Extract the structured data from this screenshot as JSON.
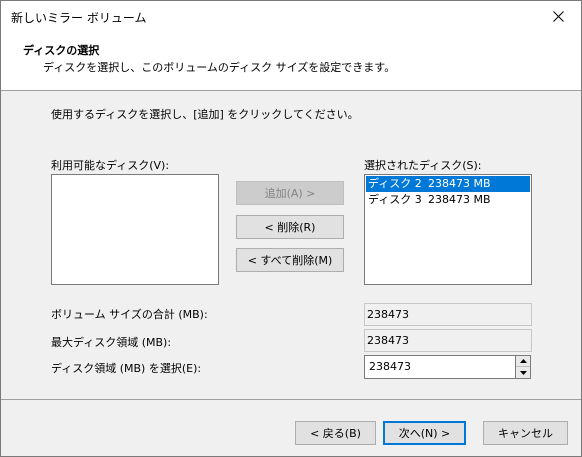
{
  "window": {
    "title": "新しいミラー ボリューム"
  },
  "header": {
    "title": "ディスクの選択",
    "subtitle": "ディスクを選択し、このボリュームのディスク サイズを設定できます。"
  },
  "instruction": "使用するディスクを選択し、[追加] をクリックしてください。",
  "available": {
    "label": "利用可能なディスク(V):",
    "items": []
  },
  "selected": {
    "label": "選択されたディスク(S):",
    "items": [
      {
        "name": "ディスク 2",
        "size": "238473 MB",
        "selected": true
      },
      {
        "name": "ディスク 3",
        "size": "238473 MB",
        "selected": false
      }
    ]
  },
  "buttons": {
    "add": "追加(A) >",
    "remove": "< 削除(R)",
    "remove_all": "< すべて削除(M)",
    "back": "< 戻る(B)",
    "next": "次へ(N) >",
    "cancel": "キャンセル"
  },
  "fields": {
    "total_label": "ボリューム サイズの合計 (MB):",
    "total_value": "238473",
    "max_label": "最大ディスク領域 (MB):",
    "max_value": "238473",
    "select_label": "ディスク領域 (MB) を選択(E):",
    "select_value": "238473"
  },
  "colors": {
    "selection": "#0078d7",
    "accent": "#0078d7"
  }
}
